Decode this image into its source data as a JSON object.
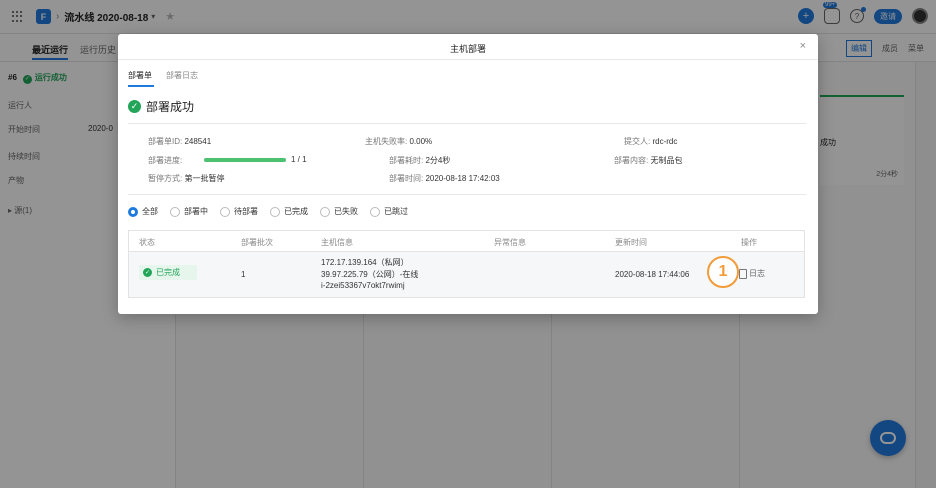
{
  "header": {
    "breadcrumb_sep": "›",
    "pipeline_title": "流水线 2020-08-18",
    "dropdown_caret": "▾",
    "star": "★",
    "plus": "+",
    "notification_count": "99+",
    "help": "?",
    "invite_label": "邀请"
  },
  "subnav": {
    "tabs": [
      {
        "label": "最近运行"
      },
      {
        "label": "运行历史"
      }
    ],
    "edit_label": "编辑",
    "members_label": "成员",
    "menu_label": "菜单"
  },
  "left_panel": {
    "run_number": "#6",
    "run_status": "运行成功",
    "runner_label": "运行人",
    "start_label": "开始时间",
    "start_value": "2020-0",
    "duration_label": "持续时间",
    "artifacts_label": "产物",
    "sources_label": "源(1)"
  },
  "stage_card": {
    "status": "成功",
    "duration": "2分4秒"
  },
  "modal": {
    "title": "主机部署",
    "close": "×",
    "tabs": [
      {
        "label": "部署单"
      },
      {
        "label": "部署日志"
      }
    ],
    "success_title": "部署成功",
    "info": {
      "deploy_id_label": "部署单ID: ",
      "deploy_id": "248541",
      "progress_label": "部署进度: ",
      "progress_fraction": 1.0,
      "progress_text": "1 / 1",
      "pause_label": "暂停方式: ",
      "pause_value": "第一批暂停",
      "fail_rate_label": "主机失败率: ",
      "fail_rate": "0.00%",
      "duration_label": "部署耗时: ",
      "duration": "2分4秒",
      "time_label": "部署时间: ",
      "time": "2020-08-18 17:42:03",
      "submitter_label": "提交人: ",
      "submitter": "rdc-rdc",
      "content_label": "部署内容: ",
      "content": "无制品包"
    },
    "filters": [
      {
        "label": "全部",
        "checked": true
      },
      {
        "label": "部署中"
      },
      {
        "label": "待部署"
      },
      {
        "label": "已完成"
      },
      {
        "label": "已失败"
      },
      {
        "label": "已跳过"
      }
    ],
    "table": {
      "columns": [
        "状态",
        "部署批次",
        "主机信息",
        "异常信息",
        "更新时间",
        "操作"
      ],
      "rows": [
        {
          "status": "已完成",
          "batch": "1",
          "host_private": "172.17.139.164（私网）",
          "host_public": "39.97.225.79（公网）-在线",
          "host_id": "i-2zei53367v7okt7rwimj",
          "error": "",
          "updated": "2020-08-18 17:44:06",
          "action": "日志"
        }
      ]
    },
    "marker": "1"
  },
  "colors": {
    "accent": "#1f7ae0",
    "success": "#22a559",
    "marker": "#f29b38"
  }
}
